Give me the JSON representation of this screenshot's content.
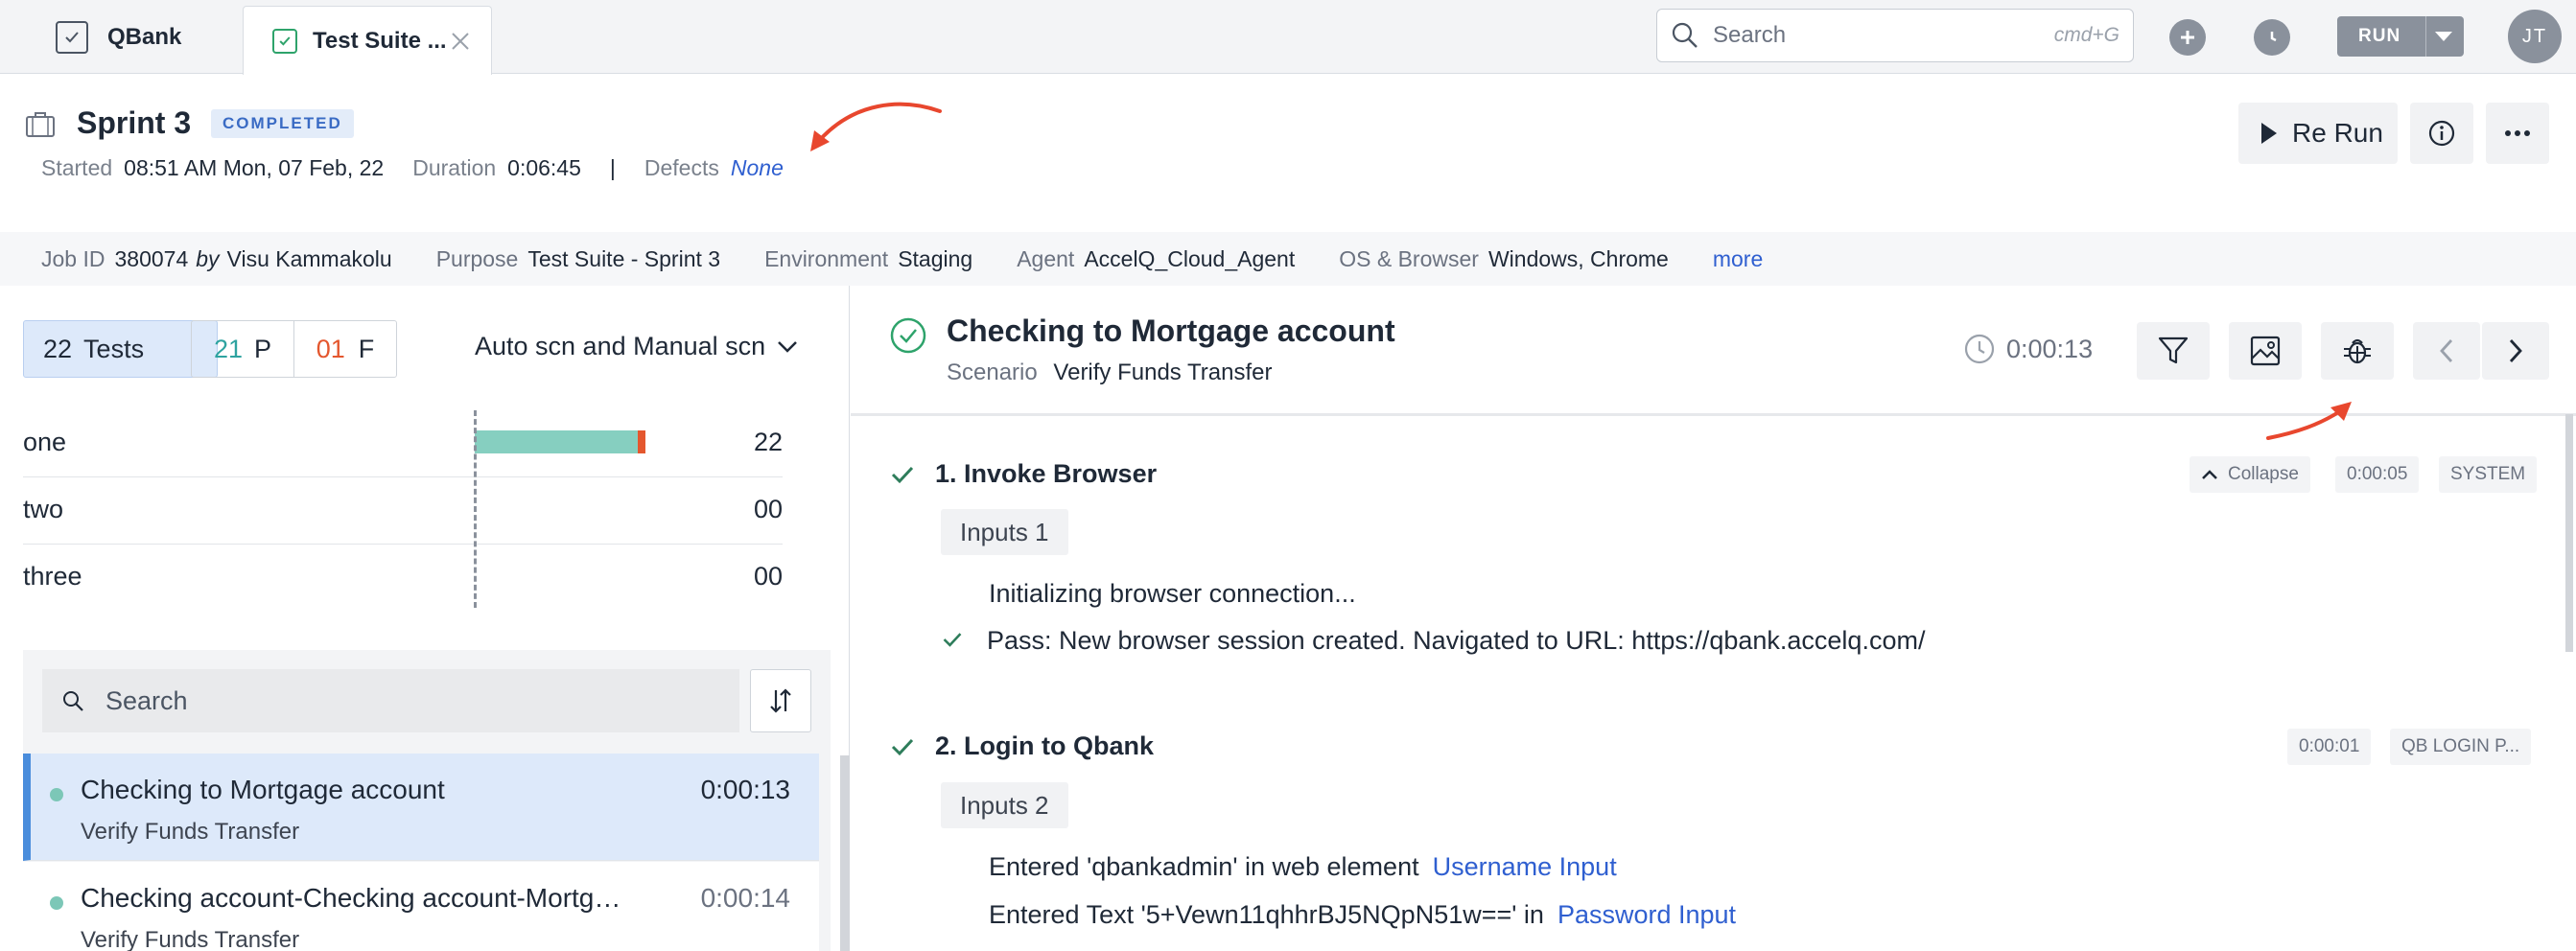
{
  "tabs": [
    {
      "label": "QBank"
    },
    {
      "label": "Test Suite ..."
    }
  ],
  "topbar": {
    "search_placeholder": "Search",
    "search_shortcut": "cmd+G",
    "run_label": "RUN",
    "avatar_initials": "JT"
  },
  "header": {
    "title": "Sprint 3",
    "status": "COMPLETED",
    "started_label": "Started",
    "started_value": "08:51 AM Mon, 07 Feb, 22",
    "duration_label": "Duration",
    "duration_value": "0:06:45",
    "separator": "|",
    "defects_label": "Defects",
    "defects_value": "None",
    "rerun_label": "Re Run"
  },
  "info": {
    "job_id_label": "Job ID",
    "job_id_value": "380074",
    "by_label": "by",
    "by_value": "Visu Kammakolu",
    "purpose_label": "Purpose",
    "purpose_value": "Test Suite - Sprint 3",
    "environment_label": "Environment",
    "environment_value": "Staging",
    "agent_label": "Agent",
    "agent_value": "AccelQ_Cloud_Agent",
    "os_label": "OS & Browser",
    "os_value": "Windows, Chrome",
    "more_label": "more"
  },
  "summary": {
    "tests_count": "22",
    "tests_label": "Tests",
    "pass_count": "21",
    "pass_label": "P",
    "fail_count": "01",
    "fail_label": "F",
    "filter_label": "Auto scn and Manual scn"
  },
  "groups": [
    {
      "name": "one",
      "count": "22",
      "pass": 21,
      "fail": 1
    },
    {
      "name": "two",
      "count": "00",
      "pass": 0,
      "fail": 0
    },
    {
      "name": "three",
      "count": "00",
      "pass": 0,
      "fail": 0
    }
  ],
  "list": {
    "search_placeholder": "Search",
    "items": [
      {
        "title": "Checking to Mortgage account",
        "subtitle": "Verify Funds Transfer",
        "duration": "0:00:13"
      },
      {
        "title": "Checking account-Checking account-Mortg…",
        "subtitle": "Verify Funds Transfer",
        "duration": "0:00:14"
      }
    ]
  },
  "detail": {
    "title": "Checking to Mortgage account",
    "scenario_label": "Scenario",
    "scenario_value": "Verify Funds Transfer",
    "duration": "0:00:13",
    "steps": [
      {
        "title": "1. Invoke Browser",
        "collapse_label": "Collapse",
        "duration": "0:00:05",
        "owner": "SYSTEM",
        "inputs_label": "Inputs 1",
        "logs": [
          "Initializing browser connection...",
          "Pass: New browser session created. Navigated to URL: https://qbank.accelq.com/"
        ]
      },
      {
        "title": "2. Login to Qbank",
        "duration": "0:00:01",
        "owner": "QB LOGIN P...",
        "inputs_label": "Inputs 2",
        "logs": [
          {
            "text": "Entered 'qbankadmin' in web element",
            "link": "Username Input"
          },
          {
            "text": "Entered Text '5+Vewn11qhhrBJ5NQpN51w==' in",
            "link": "Password Input"
          }
        ]
      }
    ]
  },
  "colors": {
    "accent": "#2f5fd0",
    "pass": "#2ea3a0",
    "fail": "#e4572e",
    "annotation_arrow": "#e8472e"
  }
}
